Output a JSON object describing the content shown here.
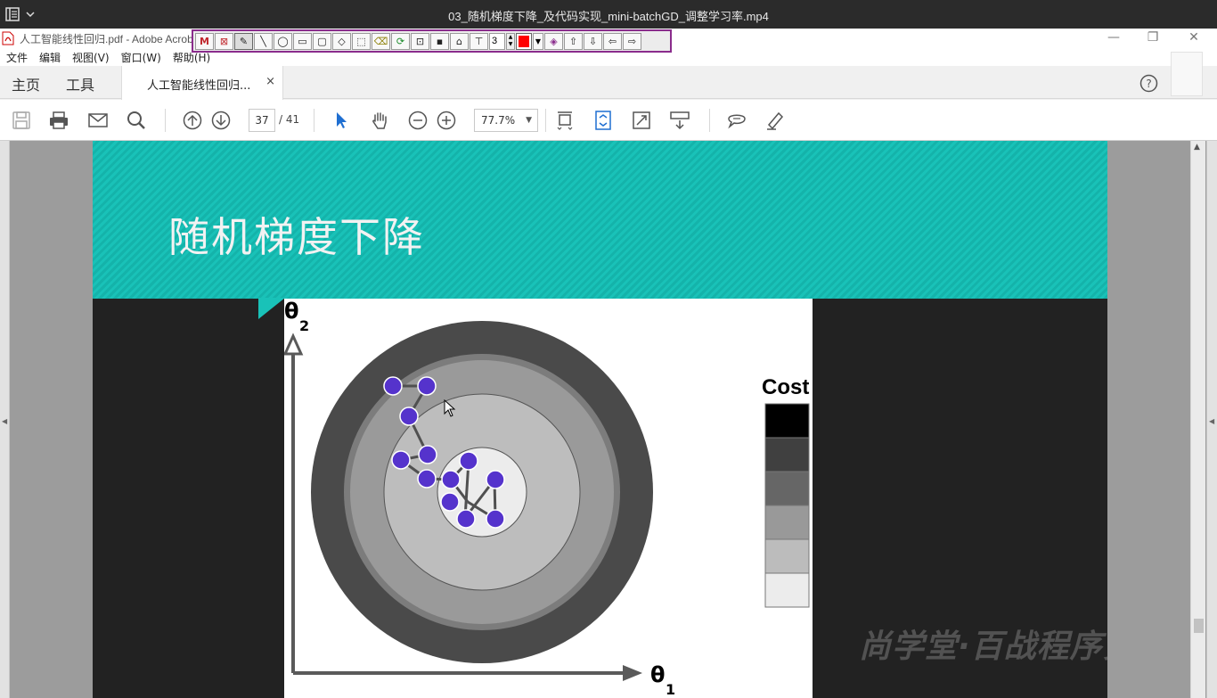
{
  "player": {
    "title": "03_随机梯度下降_及代码实现_mini-batchGD_调整学习率.mp4",
    "menu_icon": "sidebar-list-icon"
  },
  "acrobat": {
    "window_title": "人工智能线性回归.pdf - Adobe Acrobat",
    "menu": [
      "文件",
      "编辑",
      "视图(V)",
      "窗口(W)",
      "帮助(H)"
    ],
    "tabs": {
      "home": "主页",
      "tools": "工具",
      "document": "人工智能线性回归...",
      "close": "×"
    },
    "annotation_toolbar": {
      "line_width": "3",
      "color": "#ff0000"
    },
    "toolbar": {
      "page_current": "37",
      "page_total": "/ 41",
      "zoom": "77.7%"
    }
  },
  "slide": {
    "title": "随机梯度下降",
    "theta2_label": "θ",
    "theta2_sub": "2",
    "theta1_label": "θ",
    "theta1_sub": "1",
    "cost_label": "Cost",
    "cost_legend_colors": [
      "#000000",
      "#404040",
      "#666666",
      "#999999",
      "#bcbcbc",
      "#ececec"
    ],
    "contour_colors": [
      "#4a4a4a",
      "#7c7c7c",
      "#9a9a9a",
      "#bdbdbd",
      "#ececec"
    ],
    "path_point_color": "#5533cc"
  },
  "watermark": "尚学堂·百战程序员"
}
